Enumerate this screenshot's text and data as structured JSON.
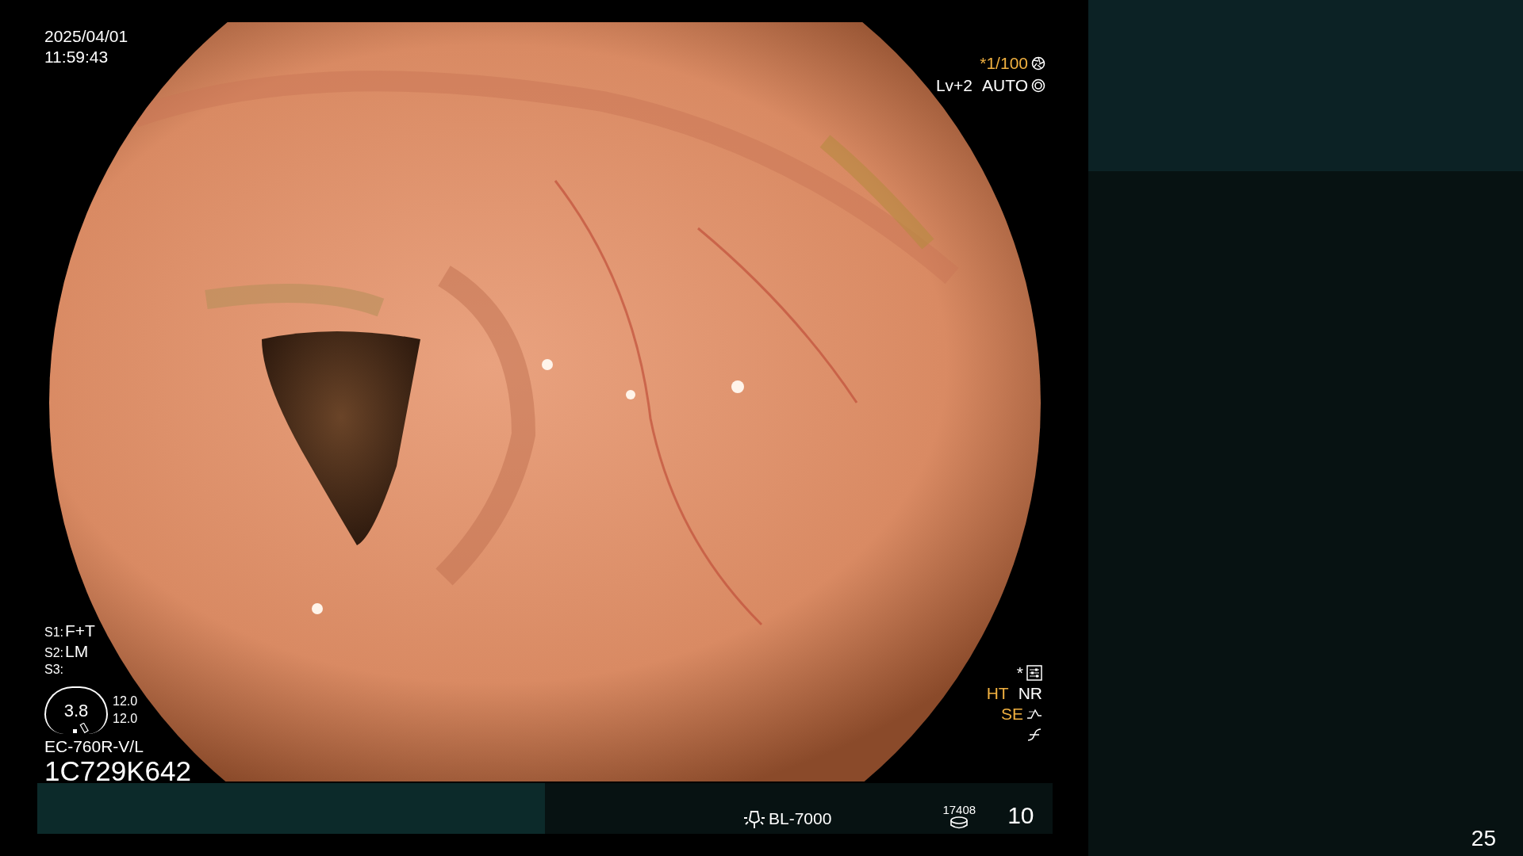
{
  "overlay": {
    "date": "2025/04/01",
    "time": "11:59:43",
    "shutter": {
      "text": "*1/100",
      "color": "#f0b040"
    },
    "exposure": {
      "level_text": "Lv+2",
      "mode": "AUTO"
    },
    "settings": [
      {
        "label": "S1:",
        "value": "F+T"
      },
      {
        "label": "S2:",
        "value": "LM"
      },
      {
        "label": "S3:"
      }
    ],
    "zoom_value": "3.8",
    "readings": [
      "12.0",
      "12.0"
    ],
    "scope_model": "EC-760R-V/L",
    "serial": "1C729K642",
    "preset_mark": "*",
    "enhancements": [
      {
        "text": "HT",
        "color": "#f0b040"
      },
      {
        "text": "NR",
        "color": "#ffffff"
      }
    ],
    "edge_enhancement": {
      "text": "SE",
      "color": "#f0b040"
    }
  },
  "status_bar": {
    "light_source": "BL-7000",
    "counter": "17408",
    "number": "10"
  },
  "page_number": "25"
}
